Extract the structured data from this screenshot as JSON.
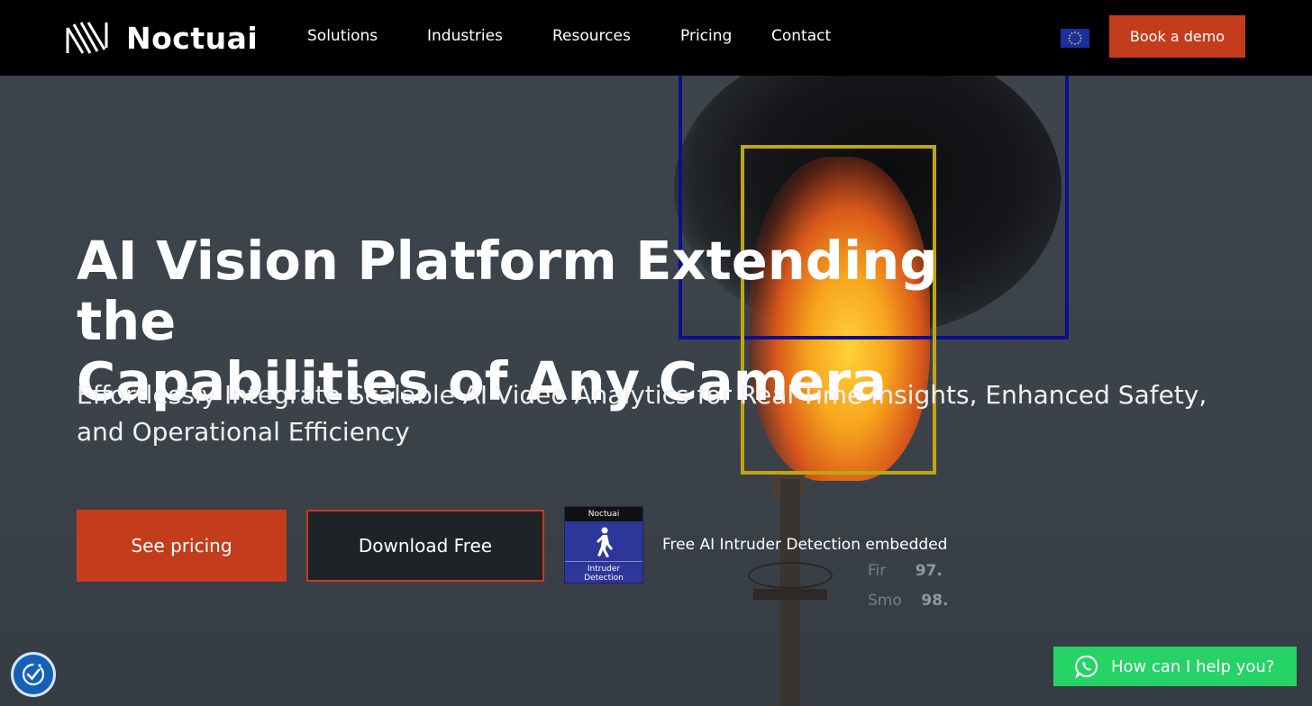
{
  "nav": {
    "brand": "Noctuai",
    "items": [
      {
        "label": "Solutions"
      },
      {
        "label": "Industries"
      },
      {
        "label": "Resources"
      },
      {
        "label": "Pricing"
      },
      {
        "label": "Contact"
      }
    ],
    "demo_button": "Book a demo"
  },
  "hero": {
    "title_line1": "AI Vision Platform Extending the",
    "title_line2": "Capabilities of Any Camera",
    "subtitle_line1": "Effortlessly Integrate Scalable AI Video Analytics for Real-Time Insights, Enhanced Safety,",
    "subtitle_line2": "and Operational Efficiency",
    "primary_button": "See pricing",
    "secondary_button": "Download Free",
    "badge": {
      "brand": "Noctuai",
      "line1": "Intruder",
      "line2": "Detection"
    },
    "badge_caption": "Free AI Intruder Detection embedded",
    "stats": [
      {
        "label": "Fir",
        "value": "97."
      },
      {
        "label": "Smo",
        "value": "98."
      }
    ]
  },
  "chat": {
    "label": "How can I help you?"
  },
  "colors": {
    "accent": "#c33d1c",
    "whatsapp": "#25d366",
    "nav_bg": "#000000"
  }
}
